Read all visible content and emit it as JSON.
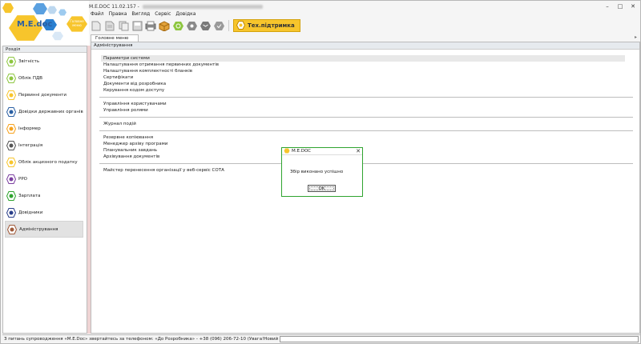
{
  "window": {
    "title": "M.E.DOC 11.02.157 -"
  },
  "logo": {
    "text": "M.E.doc",
    "badge": "Головне меню"
  },
  "menu": [
    "Файл",
    "Правка",
    "Вигляд",
    "Сервіс",
    "Довідка"
  ],
  "toolbar": {
    "support_label": "Тех.підтримка"
  },
  "tabs": {
    "main_tab": "Головне меню",
    "overflow_glyph": "▸"
  },
  "sidebar": {
    "header": "Розділ",
    "items": [
      {
        "label": "Звітність",
        "icon": "report-icon",
        "color": "#8dc63f"
      },
      {
        "label": "Облік ПДВ",
        "icon": "vat-icon",
        "color": "#8dc63f"
      },
      {
        "label": "Первинні документи",
        "icon": "documents-icon",
        "color": "#f7c52c"
      },
      {
        "label": "Довідки державних органів",
        "icon": "gov-icon",
        "color": "#2a5fa3"
      },
      {
        "label": "Інформер",
        "icon": "informer-icon",
        "color": "#f7a21c"
      },
      {
        "label": "Інтеграція",
        "icon": "integration-icon",
        "color": "#555555"
      },
      {
        "label": "Облік акцизного податку",
        "icon": "excise-icon",
        "color": "#f7c52c"
      },
      {
        "label": "РРО",
        "icon": "rro-icon",
        "color": "#7b3fa0"
      },
      {
        "label": "Зарплата",
        "icon": "salary-icon",
        "color": "#2fa42f"
      },
      {
        "label": "Довідники",
        "icon": "directory-icon",
        "color": "#2a3f8a"
      },
      {
        "label": "Адміністрування",
        "icon": "admin-icon",
        "color": "#a05a3a"
      }
    ]
  },
  "main": {
    "header": "Адміністрування",
    "groups": [
      [
        "Параметри системи",
        "Налаштування отримання первинних документів",
        "Налаштування комплектності бланків",
        "Сертифікати",
        "Документи від розробника",
        "Керування кодом доступу"
      ],
      [
        "Управління користувачами",
        "Управління ролями"
      ],
      [
        "Журнал подій"
      ],
      [
        "Резервне копіювання",
        "Менеджер архіву програми",
        "Планувальник завдань",
        "Архівування документів"
      ],
      [
        "Майстер перенесення організації у веб-сервіс СОТА"
      ]
    ]
  },
  "status": {
    "text": "З питань супроводження «M.E.Doc» звертайтесь за телефоном: «До Розробника» - +38 (096) 206-72-10 (Увага!Новий номер)"
  },
  "dialog": {
    "title": "M.E.DOC",
    "message": "Збір виконано успішно",
    "ok": "OK",
    "close": "✕"
  }
}
